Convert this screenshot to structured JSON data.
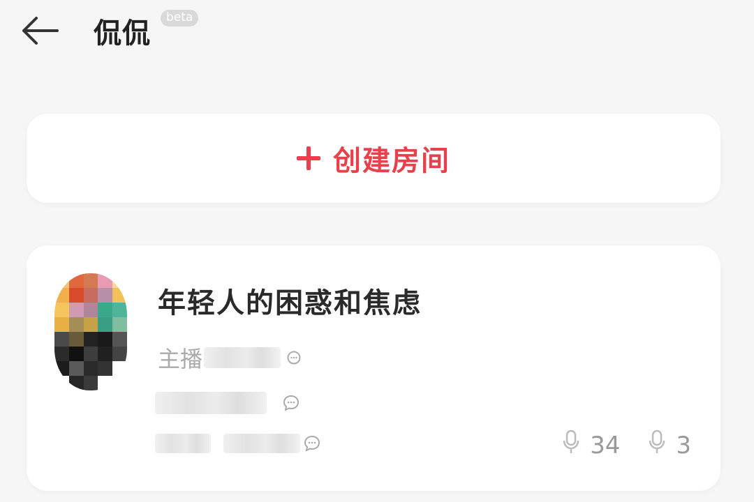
{
  "header": {
    "title": "侃侃",
    "badge": "beta",
    "back_icon": "arrow-left-icon"
  },
  "create_room": {
    "icon": "plus-icon",
    "label": "创建房间",
    "accent_color": "#e8414b"
  },
  "room": {
    "title": "年轻人的困惑和焦虑",
    "host_label": "主播",
    "stats": {
      "speakers": "34",
      "listeners": "3"
    }
  }
}
